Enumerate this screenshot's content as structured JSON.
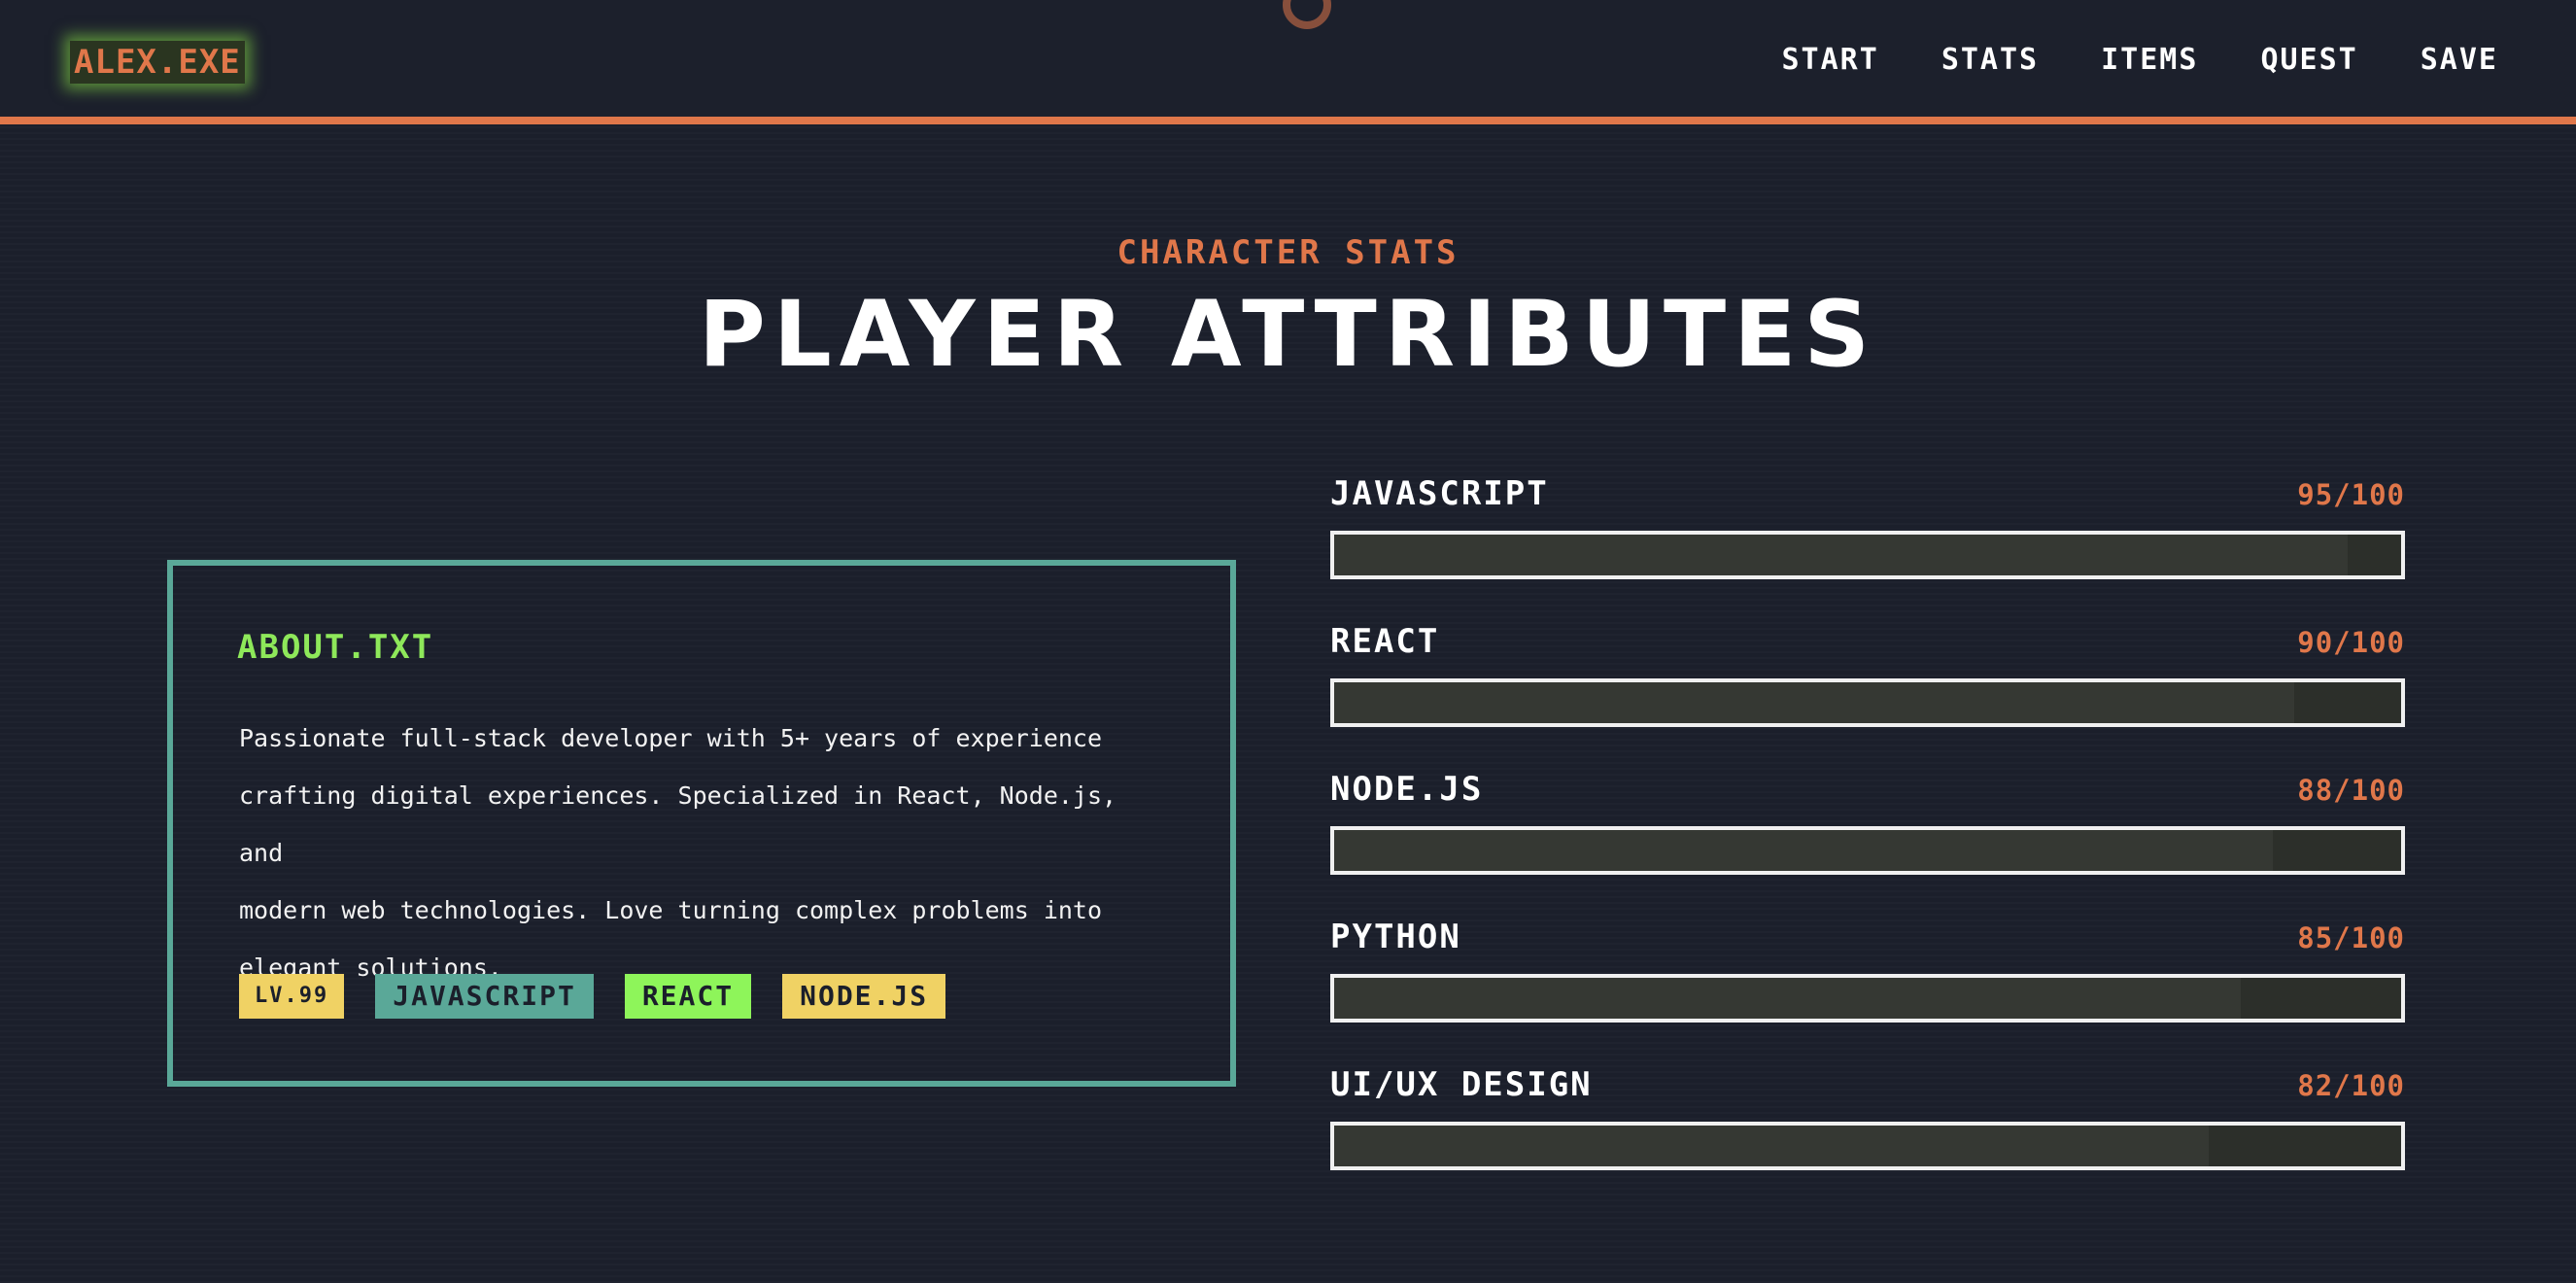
{
  "header": {
    "logo": "ALEX.EXE",
    "nav": [
      "START",
      "STATS",
      "ITEMS",
      "QUEST",
      "SAVE"
    ]
  },
  "section": {
    "subtitle": "CHARACTER STATS",
    "title": "PLAYER ATTRIBUTES"
  },
  "about": {
    "title": "ABOUT.TXT",
    "lines": [
      "Passionate full-stack developer with 5+ years of experience",
      "crafting digital experiences. Specialized in React, Node.js, and",
      "modern web technologies. Love turning complex problems into",
      "elegant solutions."
    ],
    "tags": [
      {
        "label": "LV.99",
        "color": "#f0d264"
      },
      {
        "label": "JAVASCRIPT",
        "color": "#5aa898"
      },
      {
        "label": "REACT",
        "color": "#8ef55a"
      },
      {
        "label": "NODE.JS",
        "color": "#f0d264"
      }
    ]
  },
  "skills": [
    {
      "name": "JAVASCRIPT",
      "value_label": "95/100",
      "level": 95
    },
    {
      "name": "REACT",
      "value_label": "90/100",
      "level": 90
    },
    {
      "name": "NODE.JS",
      "value_label": "88/100",
      "level": 88
    },
    {
      "name": "PYTHON",
      "value_label": "85/100",
      "level": 85
    },
    {
      "name": "UI/UX DESIGN",
      "value_label": "82/100",
      "level": 82
    }
  ],
  "colors": {
    "background": "#1b1f2b",
    "accent": "#e0774a",
    "teal": "#5aa898",
    "green": "#8ee85a",
    "yellow": "#f0d264"
  }
}
